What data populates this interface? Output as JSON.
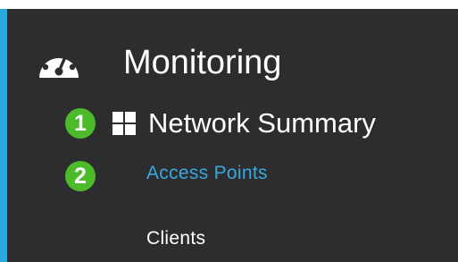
{
  "nav": {
    "monitoring": {
      "label": "Monitoring",
      "icon": "dashboard-gauge-icon"
    },
    "network_summary": {
      "label": "Network Summary",
      "icon": "grid-icon"
    },
    "items": [
      {
        "label": "Access Points",
        "active": true
      },
      {
        "label": "Clients",
        "active": false
      }
    ]
  },
  "badges": [
    "1",
    "2"
  ],
  "colors": {
    "panel_bg": "#2d2d2f",
    "accent_bar": "#27a9df",
    "active_link": "#38a8df",
    "badge": "#4cba2a",
    "text": "#ffffff"
  }
}
